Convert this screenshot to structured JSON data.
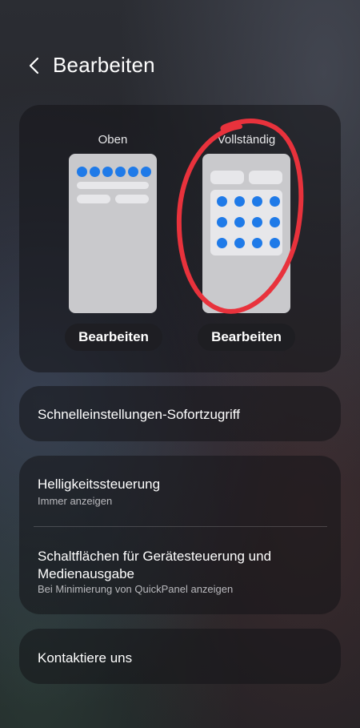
{
  "header": {
    "title": "Bearbeiten",
    "back_icon": "chevron-left-icon"
  },
  "layouts": {
    "top": {
      "label": "Oben",
      "button_label": "Bearbeiten"
    },
    "full": {
      "label": "Vollständig",
      "button_label": "Bearbeiten"
    }
  },
  "settings": {
    "quick_access": {
      "title": "Schnelleinstellungen-Sofortzugriff"
    },
    "brightness": {
      "title": "Helligkeitssteuerung",
      "subtitle": "Immer anzeigen"
    },
    "device_controls": {
      "title_line1": "Schaltflächen für Gerätesteuerung und",
      "title_line2": "Medienausgabe",
      "subtitle": "Bei Minimierung von QuickPanel anzeigen"
    },
    "contact": {
      "title": "Kontaktiere uns"
    }
  },
  "colors": {
    "accent": "#1f7ae8",
    "annotation": "#e8323c"
  }
}
